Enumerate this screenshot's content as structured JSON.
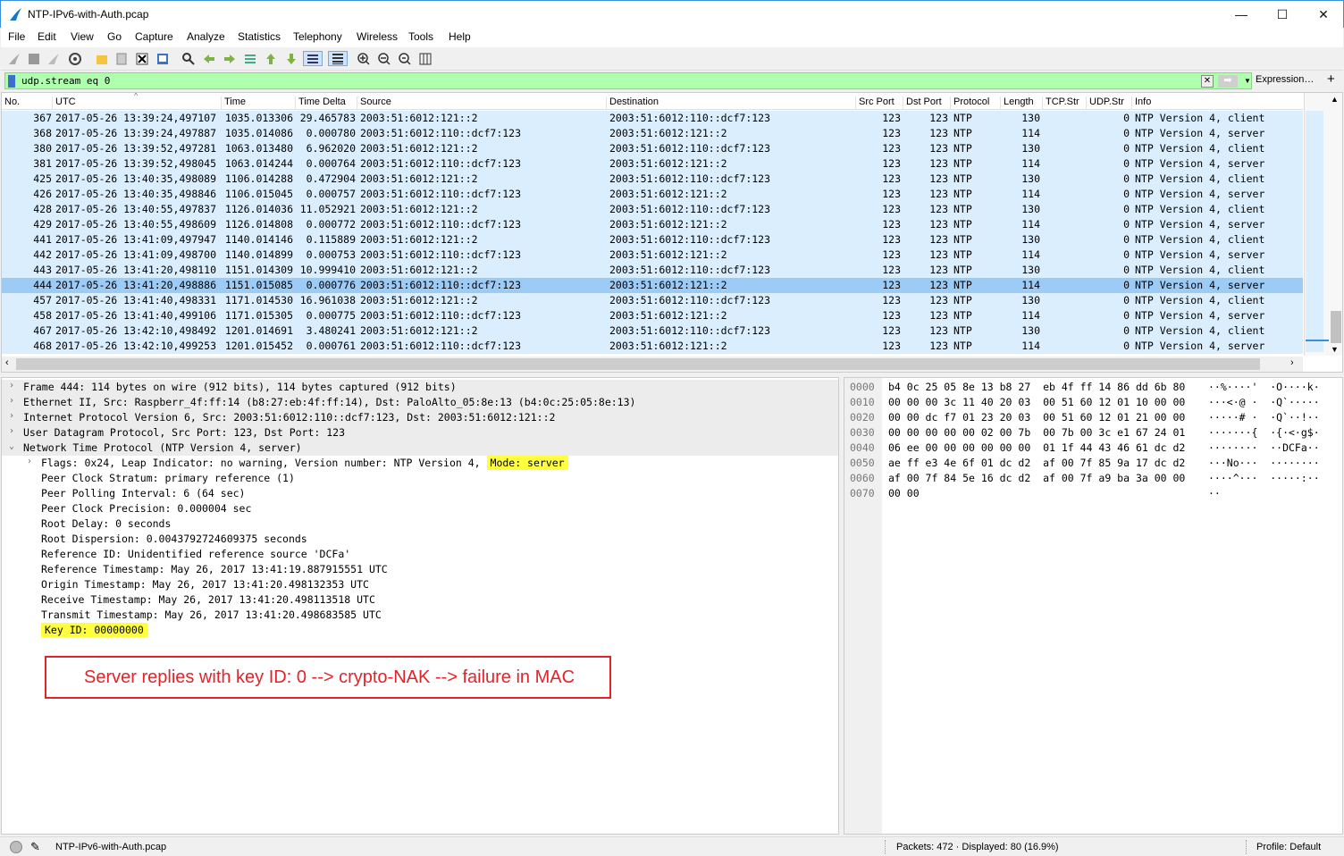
{
  "window": {
    "title": "NTP-IPv6-with-Auth.pcap",
    "minimize": "—",
    "maximize": "☐",
    "close": "✕"
  },
  "menu": [
    "File",
    "Edit",
    "View",
    "Go",
    "Capture",
    "Analyze",
    "Statistics",
    "Telephony",
    "Wireless",
    "Tools",
    "Help"
  ],
  "filter": {
    "value": "udp.stream eq 0",
    "expression_label": "Expression…",
    "add_label": "+"
  },
  "packet_list": {
    "columns": [
      "No.",
      "UTC",
      "Time",
      "Time Delta",
      "Source",
      "Destination",
      "Src Port",
      "Dst Port",
      "Protocol",
      "Length",
      "TCP.Str",
      "UDP.Str",
      "Info"
    ],
    "rows": [
      [
        "367",
        "2017-05-26 13:39:24,497107",
        "1035.013306",
        "29.465783",
        "2003:51:6012:121::2",
        "2003:51:6012:110::dcf7:123",
        "123",
        "123",
        "NTP",
        "130",
        "",
        "0",
        "NTP Version 4, client"
      ],
      [
        "368",
        "2017-05-26 13:39:24,497887",
        "1035.014086",
        "0.000780",
        "2003:51:6012:110::dcf7:123",
        "2003:51:6012:121::2",
        "123",
        "123",
        "NTP",
        "114",
        "",
        "0",
        "NTP Version 4, server"
      ],
      [
        "380",
        "2017-05-26 13:39:52,497281",
        "1063.013480",
        "6.962020",
        "2003:51:6012:121::2",
        "2003:51:6012:110::dcf7:123",
        "123",
        "123",
        "NTP",
        "130",
        "",
        "0",
        "NTP Version 4, client"
      ],
      [
        "381",
        "2017-05-26 13:39:52,498045",
        "1063.014244",
        "0.000764",
        "2003:51:6012:110::dcf7:123",
        "2003:51:6012:121::2",
        "123",
        "123",
        "NTP",
        "114",
        "",
        "0",
        "NTP Version 4, server"
      ],
      [
        "425",
        "2017-05-26 13:40:35,498089",
        "1106.014288",
        "0.472904",
        "2003:51:6012:121::2",
        "2003:51:6012:110::dcf7:123",
        "123",
        "123",
        "NTP",
        "130",
        "",
        "0",
        "NTP Version 4, client"
      ],
      [
        "426",
        "2017-05-26 13:40:35,498846",
        "1106.015045",
        "0.000757",
        "2003:51:6012:110::dcf7:123",
        "2003:51:6012:121::2",
        "123",
        "123",
        "NTP",
        "114",
        "",
        "0",
        "NTP Version 4, server"
      ],
      [
        "428",
        "2017-05-26 13:40:55,497837",
        "1126.014036",
        "11.052921",
        "2003:51:6012:121::2",
        "2003:51:6012:110::dcf7:123",
        "123",
        "123",
        "NTP",
        "130",
        "",
        "0",
        "NTP Version 4, client"
      ],
      [
        "429",
        "2017-05-26 13:40:55,498609",
        "1126.014808",
        "0.000772",
        "2003:51:6012:110::dcf7:123",
        "2003:51:6012:121::2",
        "123",
        "123",
        "NTP",
        "114",
        "",
        "0",
        "NTP Version 4, server"
      ],
      [
        "441",
        "2017-05-26 13:41:09,497947",
        "1140.014146",
        "0.115889",
        "2003:51:6012:121::2",
        "2003:51:6012:110::dcf7:123",
        "123",
        "123",
        "NTP",
        "130",
        "",
        "0",
        "NTP Version 4, client"
      ],
      [
        "442",
        "2017-05-26 13:41:09,498700",
        "1140.014899",
        "0.000753",
        "2003:51:6012:110::dcf7:123",
        "2003:51:6012:121::2",
        "123",
        "123",
        "NTP",
        "114",
        "",
        "0",
        "NTP Version 4, server"
      ],
      [
        "443",
        "2017-05-26 13:41:20,498110",
        "1151.014309",
        "10.999410",
        "2003:51:6012:121::2",
        "2003:51:6012:110::dcf7:123",
        "123",
        "123",
        "NTP",
        "130",
        "",
        "0",
        "NTP Version 4, client"
      ],
      [
        "444",
        "2017-05-26 13:41:20,498886",
        "1151.015085",
        "0.000776",
        "2003:51:6012:110::dcf7:123",
        "2003:51:6012:121::2",
        "123",
        "123",
        "NTP",
        "114",
        "",
        "0",
        "NTP Version 4, server"
      ],
      [
        "457",
        "2017-05-26 13:41:40,498331",
        "1171.014530",
        "16.961038",
        "2003:51:6012:121::2",
        "2003:51:6012:110::dcf7:123",
        "123",
        "123",
        "NTP",
        "130",
        "",
        "0",
        "NTP Version 4, client"
      ],
      [
        "458",
        "2017-05-26 13:41:40,499106",
        "1171.015305",
        "0.000775",
        "2003:51:6012:110::dcf7:123",
        "2003:51:6012:121::2",
        "123",
        "123",
        "NTP",
        "114",
        "",
        "0",
        "NTP Version 4, server"
      ],
      [
        "467",
        "2017-05-26 13:42:10,498492",
        "1201.014691",
        "3.480241",
        "2003:51:6012:121::2",
        "2003:51:6012:110::dcf7:123",
        "123",
        "123",
        "NTP",
        "130",
        "",
        "0",
        "NTP Version 4, client"
      ],
      [
        "468",
        "2017-05-26 13:42:10,499253",
        "1201.015452",
        "0.000761",
        "2003:51:6012:110::dcf7:123",
        "2003:51:6012:121::2",
        "123",
        "123",
        "NTP",
        "114",
        "",
        "0",
        "NTP Version 4, server"
      ]
    ],
    "selected_row": 11
  },
  "details": {
    "lines": [
      {
        "arrow": "›",
        "indent": 0,
        "text": "Frame 444: 114 bytes on wire (912 bits), 114 bytes captured (912 bits)"
      },
      {
        "arrow": "›",
        "indent": 0,
        "text": "Ethernet II, Src: Raspberr_4f:ff:14 (b8:27:eb:4f:ff:14), Dst: PaloAlto_05:8e:13 (b4:0c:25:05:8e:13)"
      },
      {
        "arrow": "›",
        "indent": 0,
        "text": "Internet Protocol Version 6, Src: 2003:51:6012:110::dcf7:123, Dst: 2003:51:6012:121::2"
      },
      {
        "arrow": "›",
        "indent": 0,
        "text": "User Datagram Protocol, Src Port: 123, Dst Port: 123"
      },
      {
        "arrow": "⌄",
        "indent": 0,
        "text": "Network Time Protocol (NTP Version 4, server)"
      },
      {
        "arrow": "›",
        "indent": 1,
        "text": "Flags: 0x24, Leap Indicator: no warning, Version number: NTP Version 4,",
        "highlight": "Mode: server"
      },
      {
        "arrow": "",
        "indent": 1,
        "text": "Peer Clock Stratum: primary reference (1)"
      },
      {
        "arrow": "",
        "indent": 1,
        "text": "Peer Polling Interval: 6 (64 sec)"
      },
      {
        "arrow": "",
        "indent": 1,
        "text": "Peer Clock Precision: 0.000004 sec"
      },
      {
        "arrow": "",
        "indent": 1,
        "text": "Root Delay: 0 seconds"
      },
      {
        "arrow": "",
        "indent": 1,
        "text": "Root Dispersion: 0.0043792724609375 seconds"
      },
      {
        "arrow": "",
        "indent": 1,
        "text": "Reference ID: Unidentified reference source 'DCFa'"
      },
      {
        "arrow": "",
        "indent": 1,
        "text": "Reference Timestamp: May 26, 2017 13:41:19.887915551 UTC"
      },
      {
        "arrow": "",
        "indent": 1,
        "text": "Origin Timestamp: May 26, 2017 13:41:20.498132353 UTC"
      },
      {
        "arrow": "",
        "indent": 1,
        "text": "Receive Timestamp: May 26, 2017 13:41:20.498113518 UTC"
      },
      {
        "arrow": "",
        "indent": 1,
        "text": "Transmit Timestamp: May 26, 2017 13:41:20.498683585 UTC"
      },
      {
        "arrow": "",
        "indent": 1,
        "text": "",
        "highlight": "Key ID: 00000000"
      }
    ],
    "annotation": "Server replies with key ID: 0 --> crypto-NAK --> failure in MAC"
  },
  "bytes": {
    "rows": [
      {
        "offset": "0000",
        "hex": "b4 0c 25 05 8e 13 b8 27  eb 4f ff 14 86 dd 6b 80",
        "ascii": "··%····'  ·O····k·"
      },
      {
        "offset": "0010",
        "hex": "00 00 00 3c 11 40 20 03  00 51 60 12 01 10 00 00",
        "ascii": "···<·@ ·  ·Q`·····"
      },
      {
        "offset": "0020",
        "hex": "00 00 dc f7 01 23 20 03  00 51 60 12 01 21 00 00",
        "ascii": "·····# ·  ·Q`··!··"
      },
      {
        "offset": "0030",
        "hex": "00 00 00 00 00 02 00 7b  00 7b 00 3c e1 67 24 01",
        "ascii": "·······{  ·{·<·g$·"
      },
      {
        "offset": "0040",
        "hex": "06 ee 00 00 00 00 00 00  01 1f 44 43 46 61 dc d2",
        "ascii": "········  ··DCFa··"
      },
      {
        "offset": "0050",
        "hex": "ae ff e3 4e 6f 01 dc d2  af 00 7f 85 9a 17 dc d2",
        "ascii": "···No···  ········"
      },
      {
        "offset": "0060",
        "hex": "af 00 7f 84 5e 16 dc d2  af 00 7f a9 ba 3a 00 00",
        "ascii": "····^···  ·····:··"
      },
      {
        "offset": "0070",
        "hex": "00 00",
        "ascii": "··"
      }
    ]
  },
  "status": {
    "file": "NTP-IPv6-with-Auth.pcap",
    "packets": "Packets: 472 · Displayed: 80 (16.9%)",
    "profile": "Profile: Default"
  },
  "colors": {
    "row_bg": "#daeefe",
    "row_selected": "#9ccbf5",
    "filter_ok": "#afffaf",
    "highlight": "#ffff3f",
    "annotation": "#e2232a"
  }
}
